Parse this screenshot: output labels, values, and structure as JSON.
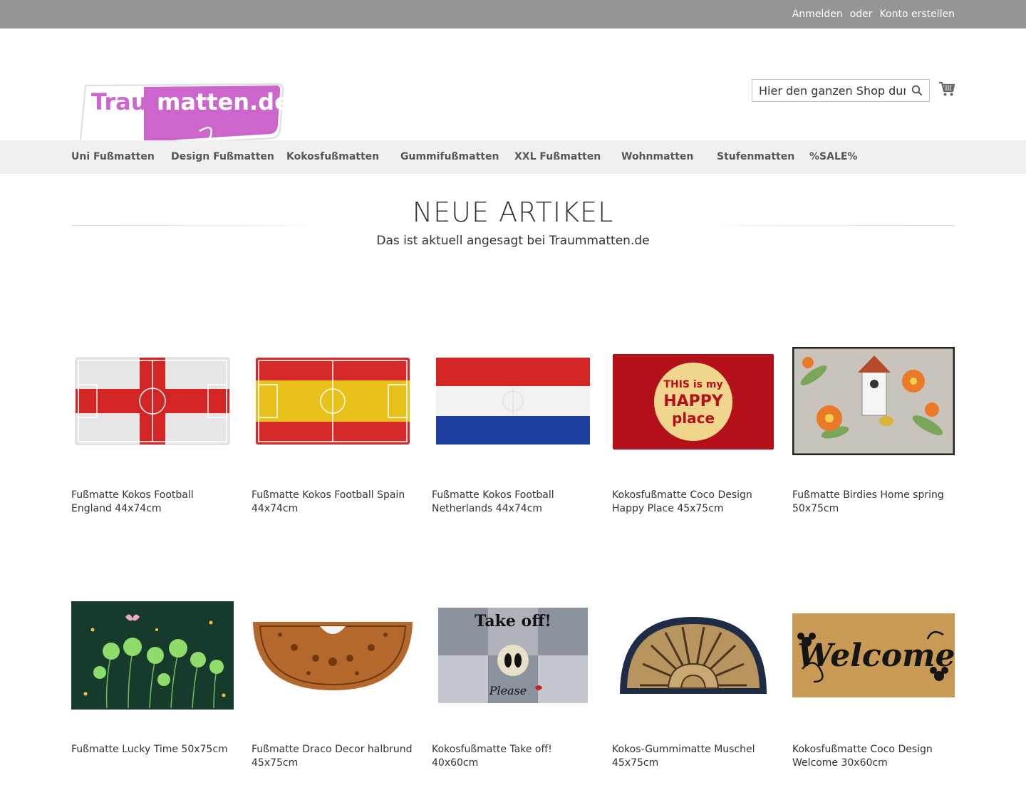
{
  "topbar": {
    "login": "Anmelden",
    "or": "oder",
    "create_account": "Konto erstellen"
  },
  "header": {
    "logo_text_main": "Traum",
    "logo_text_rest": "matten.de",
    "search_placeholder": "Hier den ganzen Shop durchsuchen...",
    "cart_icon": "shopping-cart-icon",
    "search_icon": "magnifier-icon"
  },
  "nav": {
    "items": [
      "Uni Fußmatten",
      "Design Fußmatten",
      "Kokosfußmatten",
      "Gummifußmatten",
      "XXL Fußmatten",
      "Wohnmatten",
      "Stufenmatten",
      "%SALE%"
    ]
  },
  "section": {
    "title": "NEUE ARTIKEL",
    "subtitle": "Das ist aktuell angesagt bei Traummatten.de"
  },
  "products": [
    {
      "name": "Fußmatte Kokos Football England 44x74cm",
      "image": "england-football-mat"
    },
    {
      "name": "Fußmatte Kokos Football Spain 44x74cm",
      "image": "spain-football-mat"
    },
    {
      "name": "Fußmatte Kokos Football Netherlands 44x74cm",
      "image": "netherlands-football-mat"
    },
    {
      "name": "Kokosfußmatte Coco Design Happy Place 45x75cm",
      "image": "happy-place-mat",
      "mat_text": [
        "THIS is my",
        "HAPPY",
        "place"
      ]
    },
    {
      "name": "Fußmatte Birdies Home spring 50x75cm",
      "image": "birdies-flower-mat"
    },
    {
      "name": "Fußmatte Lucky Time 50x75cm",
      "image": "lucky-clover-mat"
    },
    {
      "name": "Fußmatte Draco Decor halbrund 45x75cm",
      "image": "draco-halfround-mat"
    },
    {
      "name": "Kokosfußmatte Take off! 40x60cm",
      "image": "take-off-mat",
      "mat_text": [
        "Take off!",
        "Please"
      ]
    },
    {
      "name": "Kokos-Gummimatte Muschel 45x75cm",
      "image": "shell-halfround-mat"
    },
    {
      "name": "Kokosfußmatte Coco Design Welcome 30x60cm",
      "image": "welcome-mat",
      "mat_text": [
        "Welcome"
      ]
    }
  ],
  "colors": {
    "topbar": "#959595",
    "nav_bg": "#f0f0f0",
    "brand_purple": "#cc66cc"
  }
}
